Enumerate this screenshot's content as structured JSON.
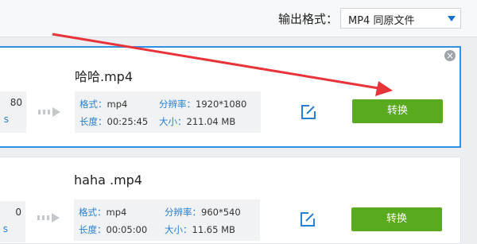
{
  "header": {
    "format_label": "输出格式：",
    "format_value": "MP4  同原文件"
  },
  "colors": {
    "accent": "#2e8fe3",
    "convert_button": "#5aaa1e",
    "label": "#2a7fd0",
    "annotation_arrow": "#e8333a"
  },
  "files": [
    {
      "name": "哈哈.mp4",
      "source_partial_1": "80",
      "source_partial_2": "s",
      "format_label": "格式：",
      "format": "mp4",
      "resolution_label": "分辨率：",
      "resolution": "1920*1080",
      "duration_label": "长度：",
      "duration": "00:25:45",
      "size_label": "大小：",
      "size": "211.04 MB",
      "convert_label": "转换",
      "close": "×"
    },
    {
      "name": "haha .mp4",
      "source_partial_1": "0",
      "source_partial_2": "s",
      "format_label": "格式：",
      "format": "mp4",
      "resolution_label": "分辨率：",
      "resolution": "960*540",
      "duration_label": "长度：",
      "duration": "00:05:00",
      "size_label": "大小：",
      "size": "11.65 MB",
      "convert_label": "转换"
    }
  ]
}
